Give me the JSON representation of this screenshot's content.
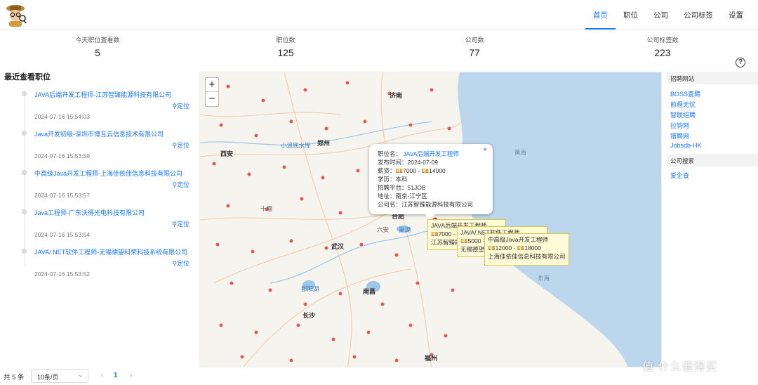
{
  "nav": {
    "items": [
      "首页",
      "职位",
      "公司",
      "公司标签",
      "设置"
    ],
    "active": 0
  },
  "stats": [
    {
      "label": "今天职位查看数",
      "value": "5"
    },
    {
      "label": "职位数",
      "value": "125"
    },
    {
      "label": "公司数",
      "value": "77"
    },
    {
      "label": "公司标签数",
      "value": "223"
    }
  ],
  "recent": {
    "title": "最近查看职位",
    "locate_label": "定位",
    "items": [
      {
        "title": "JAVA后端开发工程师-江苏智臻能源科技有限公司",
        "time": "2024-07-16 15:54:03"
      },
      {
        "title": "Java开发初级-深圳市博互云信息技术有限公司",
        "time": "2024-07-16 15:53:59"
      },
      {
        "title": "中高级Java开发工程师-上海佳依佳信息科技有限公司",
        "time": "2024-07-16 15:53:57"
      },
      {
        "title": "Java工程师-广东沃得光电科技有限公司",
        "time": "2024-07-16 15:53:54"
      },
      {
        "title": "JAVA/.NET软件工程师-无锡德望科荣科技系统有限公司",
        "time": "2024-07-16 15:53:52"
      }
    ]
  },
  "map": {
    "zoom_in": "+",
    "zoom_out": "−",
    "cities": [
      "济南",
      "郑州",
      "西安",
      "合肥",
      "武汉",
      "南昌",
      "长沙",
      "福州",
      "黄海",
      "东海",
      "小浪底水库",
      "巢湖",
      "十堰",
      "六安",
      "鄱阳湖"
    ],
    "popup": {
      "close": "×",
      "lines": [
        {
          "label": "职位名：",
          "value": "JAVA后端开发工程师"
        },
        {
          "label": "发布时间：",
          "value": "2024-07-09"
        },
        {
          "label": "薪资：",
          "value": "💴7000 - 💴14000"
        },
        {
          "label": "学历：",
          "value": "本科"
        },
        {
          "label": "招聘平台：",
          "value": "51JOB"
        },
        {
          "label": "地址：",
          "value": "南京-江宁区"
        },
        {
          "label": "公司名：",
          "value": "江苏智臻能源科技有限公司"
        }
      ]
    },
    "tooltips": [
      {
        "l1": "JAVA后端开发工程师",
        "l2": "💴7000 - 💴14000",
        "l3": "江苏智臻能源科技有限公司"
      },
      {
        "l1": "JAVA/.NET软件工程师",
        "l2": "💴5000 - 💴10000",
        "l3": "无锡德望科荣科技系统有限公司"
      },
      {
        "l1": "中高级Java开发工程师",
        "l2": "💴12000 - 💴18000",
        "l3": "上海佳依佳信息科技有限公司"
      }
    ]
  },
  "side": {
    "recruit_header": "招聘网站",
    "recruit_links": [
      "BOSS直聘",
      "前程无忧",
      "智联招聘",
      "拉钩网",
      "猎聘网",
      "Jobsdb-HK"
    ],
    "search_header": "公司搜索",
    "search_links": [
      "爱企查"
    ]
  },
  "footer": {
    "total": "共 5 条",
    "page_size": "10条/页",
    "page": "1",
    "prev": "‹",
    "next": "›"
  },
  "watermark": "值 什么值得买"
}
